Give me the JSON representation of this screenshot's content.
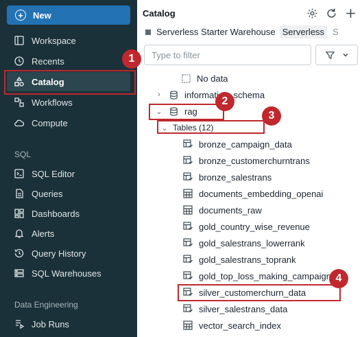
{
  "sidebar": {
    "new_label": "New",
    "items": [
      {
        "label": "Workspace",
        "icon": "workspace-icon"
      },
      {
        "label": "Recents",
        "icon": "clock-icon"
      },
      {
        "label": "Catalog",
        "icon": "catalog-icon"
      },
      {
        "label": "Workflows",
        "icon": "workflows-icon"
      },
      {
        "label": "Compute",
        "icon": "cloud-icon"
      }
    ],
    "sql_section": "SQL",
    "sql_items": [
      {
        "label": "SQL Editor",
        "icon": "sql-editor-icon"
      },
      {
        "label": "Queries",
        "icon": "queries-icon"
      },
      {
        "label": "Dashboards",
        "icon": "dashboards-icon"
      },
      {
        "label": "Alerts",
        "icon": "bell-icon"
      },
      {
        "label": "Query History",
        "icon": "history-icon"
      },
      {
        "label": "SQL Warehouses",
        "icon": "warehouse-icon"
      }
    ],
    "de_section": "Data Engineering",
    "de_items": [
      {
        "label": "Job Runs",
        "icon": "job-runs-icon"
      }
    ]
  },
  "main": {
    "title": "Catalog",
    "warehouse_name": "Serverless Starter Warehouse",
    "warehouse_tag": "Serverless",
    "warehouse_extra": "S",
    "filter_placeholder": "Type to filter",
    "tree": {
      "no_data": "No data",
      "information_schema": "information_schema",
      "rag": "rag",
      "tables_label": "Tables",
      "tables_count": "(12)",
      "tables": [
        {
          "name": "bronze_campaign_data",
          "type": "streaming"
        },
        {
          "name": "bronze_customerchurntrans",
          "type": "streaming"
        },
        {
          "name": "bronze_salestrans",
          "type": "streaming"
        },
        {
          "name": "documents_embedding_openai",
          "type": "table"
        },
        {
          "name": "documents_raw",
          "type": "table"
        },
        {
          "name": "gold_country_wise_revenue",
          "type": "streaming"
        },
        {
          "name": "gold_salestrans_lowerrank",
          "type": "streaming"
        },
        {
          "name": "gold_salestrans_toprank",
          "type": "streaming"
        },
        {
          "name": "gold_top_loss_making_campaign",
          "type": "streaming"
        },
        {
          "name": "silver_customerchurn_data",
          "type": "streaming"
        },
        {
          "name": "silver_salestrans_data",
          "type": "streaming"
        },
        {
          "name": "vector_search_index",
          "type": "table"
        }
      ]
    }
  },
  "annotations": [
    "1",
    "2",
    "3",
    "4"
  ],
  "colors": {
    "sidebar_bg": "#1b3139",
    "accent": "#2272b4",
    "highlight": "#c0282e"
  }
}
